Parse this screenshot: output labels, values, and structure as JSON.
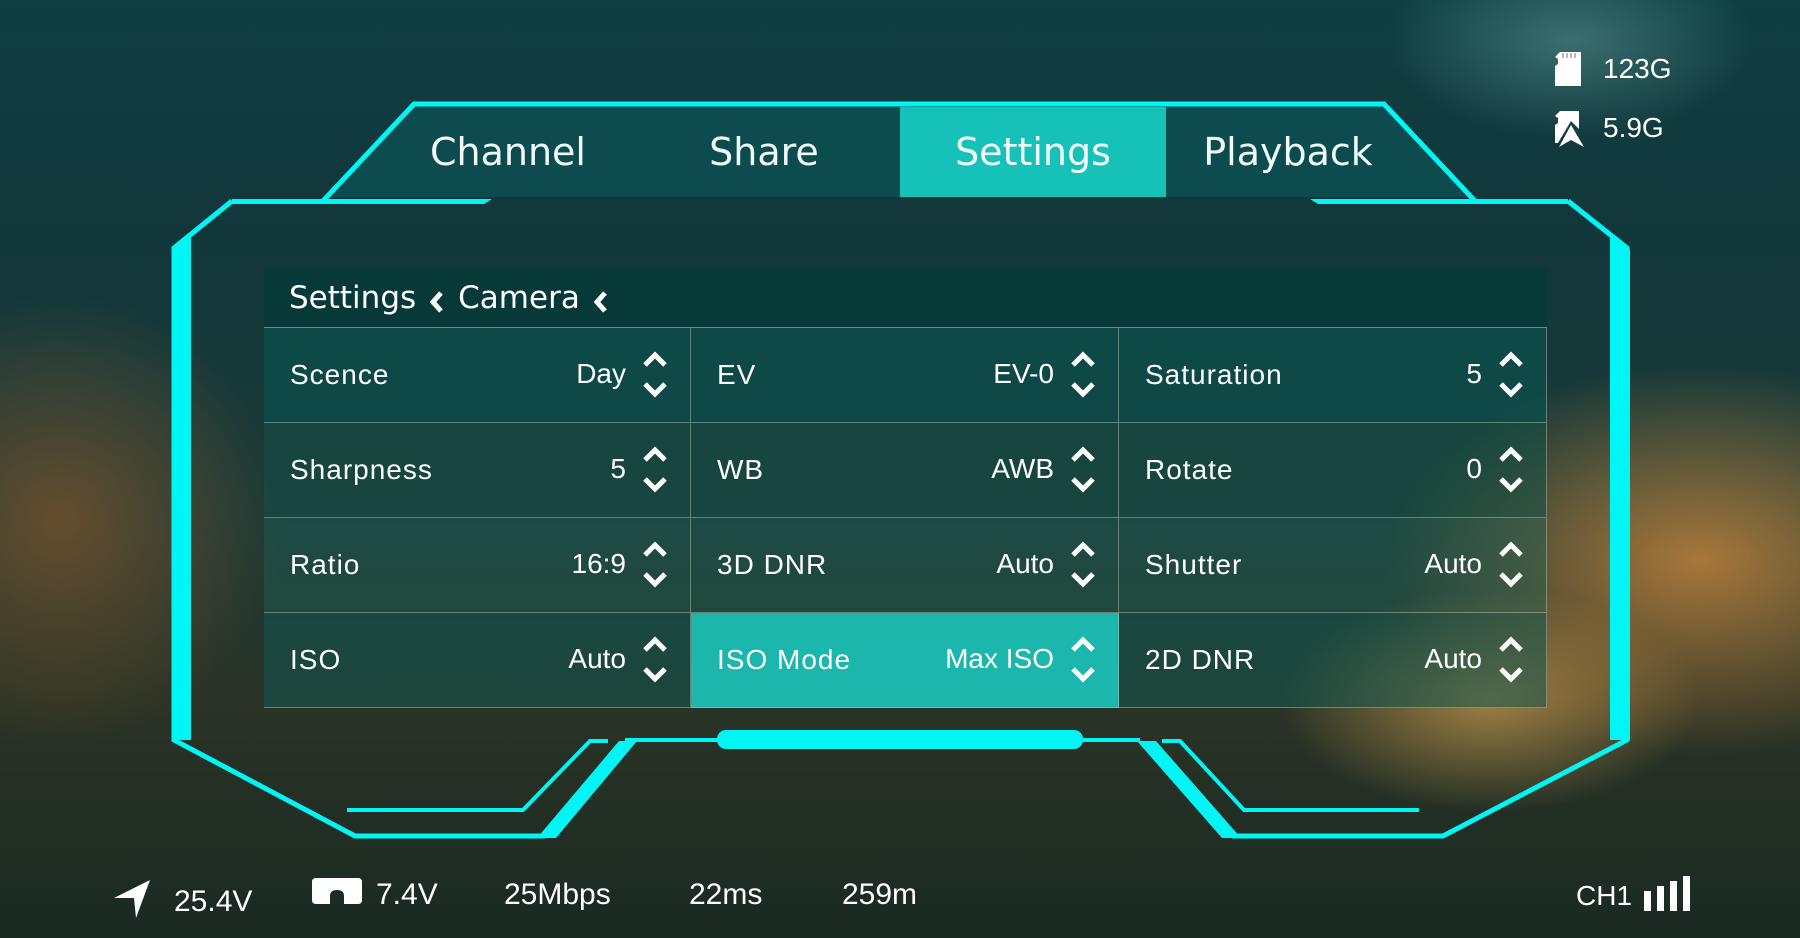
{
  "theme": {
    "accent": "#00f5f5",
    "tab_active": "#16c2b8",
    "cell_selected": "#1ac8be"
  },
  "storage": {
    "sd_total": {
      "icon": "sd-card-icon",
      "value": "123G"
    },
    "sd_recorded": {
      "icon": "sd-card-recording-icon",
      "value": "5.9G"
    }
  },
  "tabs": [
    {
      "label": "Channel",
      "active": false
    },
    {
      "label": "Share",
      "active": false
    },
    {
      "label": "Settings",
      "active": true
    },
    {
      "label": "Playback",
      "active": false
    }
  ],
  "breadcrumb": {
    "items": [
      "Settings",
      "Camera"
    ],
    "separator_icon": "chevron-left-icon"
  },
  "settings": [
    {
      "label": "Scence",
      "value": "Day"
    },
    {
      "label": "EV",
      "value": "EV-0"
    },
    {
      "label": "Saturation",
      "value": "5"
    },
    {
      "label": "Sharpness",
      "value": "5"
    },
    {
      "label": "WB",
      "value": "AWB"
    },
    {
      "label": "Rotate",
      "value": "0"
    },
    {
      "label": "Ratio",
      "value": "16:9"
    },
    {
      "label": "3D DNR",
      "value": "Auto"
    },
    {
      "label": "Shutter",
      "value": "Auto"
    },
    {
      "label": "ISO",
      "value": "Auto"
    },
    {
      "label": "ISO Mode",
      "value": "Max ISO",
      "selected": true
    },
    {
      "label": "2D DNR",
      "value": "Auto"
    }
  ],
  "status": {
    "drone_voltage": {
      "icon": "navigation-arrow-icon",
      "value": "25.4V"
    },
    "goggles_voltage": {
      "icon": "goggles-icon",
      "value": "7.4V"
    },
    "bitrate": "25Mbps",
    "latency": "22ms",
    "distance": "259m",
    "channel": "CH1",
    "signal_bars": 4,
    "signal_max": 4
  }
}
